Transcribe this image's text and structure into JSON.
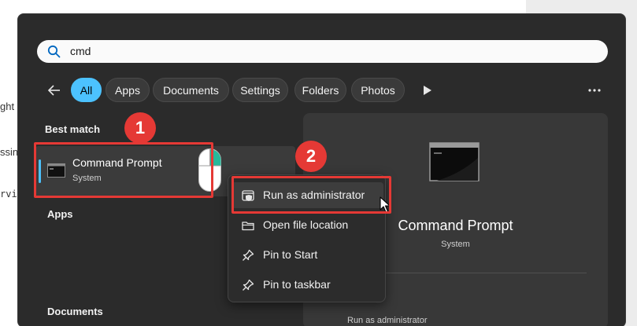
{
  "background_fragments": [
    "ght",
    "ssin",
    "rvi"
  ],
  "search": {
    "icon": "search-icon",
    "query": "cmd"
  },
  "filters": [
    {
      "label": "All",
      "active": true
    },
    {
      "label": "Apps",
      "active": false
    },
    {
      "label": "Documents",
      "active": false
    },
    {
      "label": "Settings",
      "active": false
    },
    {
      "label": "Folders",
      "active": false
    },
    {
      "label": "Photos",
      "active": false
    }
  ],
  "sections": {
    "best_match": "Best match",
    "apps": "Apps",
    "documents": "Documents"
  },
  "best_match": {
    "title": "Command Prompt",
    "subtitle": "System",
    "icon": "command-prompt-icon"
  },
  "detail": {
    "title": "Command Prompt",
    "subtitle": "System",
    "action": "Run as administrator"
  },
  "context_menu": [
    {
      "label": "Run as administrator",
      "icon": "shield-window-icon",
      "highlighted": true
    },
    {
      "label": "Open file location",
      "icon": "folder-icon",
      "highlighted": false
    },
    {
      "label": "Pin to Start",
      "icon": "pin-icon",
      "highlighted": false
    },
    {
      "label": "Pin to taskbar",
      "icon": "pin-icon",
      "highlighted": false
    }
  ],
  "annotations": {
    "step1": "1",
    "step2": "2"
  },
  "colors": {
    "accent": "#4cc2ff",
    "annotation_red": "#e53935",
    "panel_bg": "#2b2b2b"
  }
}
